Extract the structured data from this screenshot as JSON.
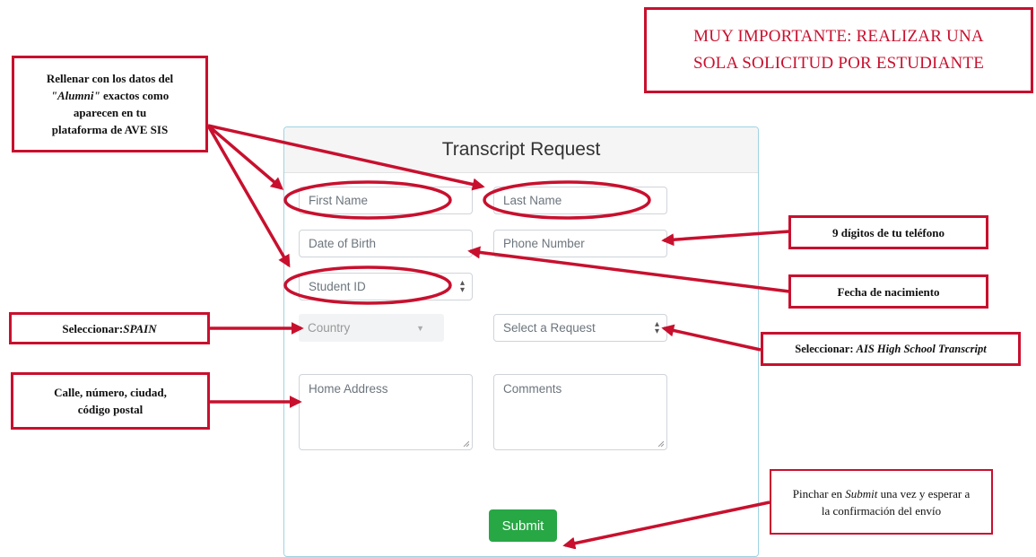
{
  "form": {
    "title": "Transcript Request",
    "first_name_placeholder": "First Name",
    "last_name_placeholder": "Last Name",
    "dob_placeholder": "Date of Birth",
    "phone_placeholder": "Phone Number",
    "student_id_placeholder": "Student ID",
    "country_placeholder": "Country",
    "request_placeholder": "Select a Request",
    "address_placeholder": "Home Address",
    "comments_placeholder": "Comments",
    "submit_label": "Submit"
  },
  "notes": {
    "important_line1": "MUY IMPORTANTE: REALIZAR UNA",
    "important_line2": "SOLA SOLICITUD POR ESTUDIANTE",
    "alumni_a": "Rellenar con los datos del",
    "alumni_b": "\"Alumni\"",
    "alumni_c": " exactos como",
    "alumni_d": "aparecen en tu",
    "alumni_e": "plataforma de AVE SIS",
    "phone": "9 dígitos de tu teléfono",
    "dob": "Fecha de nacimiento",
    "country_prefix": "Seleccionar: ",
    "country_value": "SPAIN",
    "request_prefix": "Seleccionar: ",
    "request_value": "AIS High School Transcript",
    "address_line1": "Calle, número, ciudad,",
    "address_line2": "código postal",
    "submit_a": "Pinchar en ",
    "submit_b": "Submit",
    "submit_c": " una vez y esperar a",
    "submit_d": "la confirmación del envío"
  },
  "colors": {
    "annotation": "#c8102e",
    "submit": "#28a745",
    "card_border": "#9fd3e3"
  }
}
